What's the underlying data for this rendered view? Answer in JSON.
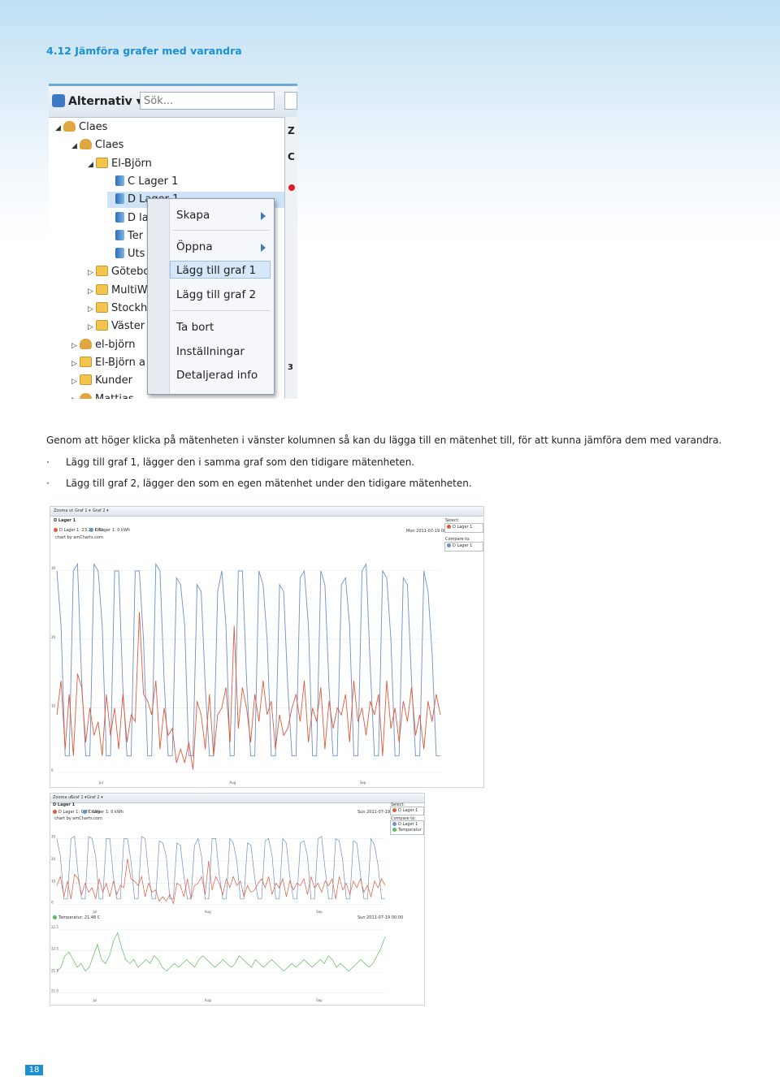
{
  "section_title": "4.12 Jämföra grafer med varandra",
  "screenshot1": {
    "toolbar": {
      "alternativ": "Alternativ",
      "search_placeholder": "Sök..."
    },
    "tree": [
      {
        "label": "Claes",
        "icon": "user-group-icon",
        "level": 0,
        "expanded": true
      },
      {
        "label": "Claes",
        "icon": "user-icon",
        "level": 1,
        "expanded": true
      },
      {
        "label": "El-Björn",
        "icon": "folder-icon",
        "level": 2,
        "expanded": true
      },
      {
        "label": "C Lager 1",
        "icon": "meter-icon",
        "level": 3
      },
      {
        "label": "D Lager 1",
        "icon": "meter-icon",
        "level": 3,
        "selected": true
      },
      {
        "label": "D la",
        "icon": "meter-icon",
        "level": 3
      },
      {
        "label": "Ter",
        "icon": "meter-icon",
        "level": 3
      },
      {
        "label": "Uts",
        "icon": "meter-icon",
        "level": 3
      },
      {
        "label": "Götebo",
        "icon": "folder-icon",
        "level": 2
      },
      {
        "label": "MultiW",
        "icon": "folder-icon",
        "level": 2
      },
      {
        "label": "Stockh",
        "icon": "folder-icon",
        "level": 2
      },
      {
        "label": "Väster",
        "icon": "folder-icon",
        "level": 2
      },
      {
        "label": "el-björn",
        "icon": "user-icon",
        "level": 1
      },
      {
        "label": "El-Björn a",
        "icon": "folder-icon",
        "level": 1
      },
      {
        "label": "Kunder",
        "icon": "folder-icon",
        "level": 1
      },
      {
        "label": "Mattias",
        "icon": "user-icon",
        "level": 1
      }
    ],
    "right_strip": [
      "Z",
      "C",
      "3"
    ],
    "context_menu": [
      {
        "label": "Skapa",
        "submenu": true
      },
      {
        "label": "Öppna",
        "submenu": true
      },
      {
        "label": "Lägg till graf 1",
        "highlighted": true
      },
      {
        "label": "Lägg till graf 2"
      },
      {
        "label": "Ta bort"
      },
      {
        "label": "Inställningar"
      },
      {
        "label": "Detaljerad info"
      }
    ]
  },
  "body": {
    "intro": "Genom att höger klicka på mätenheten i vänster kolumnen så kan du lägga till en mätenhet till, för att kunna jämföra dem med varandra.",
    "bullets": [
      "Lägg till graf 1, lägger den i samma graf som den tidigare mätenheten.",
      "Lägg till graf 2, lägger den som en egen mätenhet under den tidigare mätenheten."
    ]
  },
  "chart_screenshot_1": {
    "menu": [
      "Zooma ut",
      "Graf 1 ▾",
      "Graf 2 ▾"
    ],
    "title": "D Lager 1",
    "legend": [
      {
        "text": "D Lager 1: 23.25 kWh",
        "color": "#e05a3a"
      },
      {
        "text": "C Lager 1: 0 kWh",
        "color": "#6f8fc9"
      }
    ],
    "credit": "chart by amCharts.com",
    "date": "Mon 2011-07-19 00:00",
    "select_label": "Select:",
    "select_value": "D Lager 1",
    "compare_label": "Compare to:",
    "compare_items": [
      {
        "text": "D Lager 1",
        "color": "#6f8fc9"
      }
    ]
  },
  "chart_screenshot_2": {
    "menu": [
      "Zooma ut",
      "Graf 1 ▾",
      "Graf 2 ▾"
    ],
    "title": "D Lager 1",
    "legend": [
      {
        "text": "D Lager 1: 0.07 kWh",
        "color": "#e05a3a"
      },
      {
        "text": "C Lager 1: 0 kWh",
        "color": "#6f8fc9"
      }
    ],
    "credit": "chart by amCharts.com",
    "date": "Sun 2011-07-19 00:00",
    "select_label": "Select:",
    "select_value": "D Lager 1",
    "compare_label": "Compare to:",
    "compare_items": [
      {
        "text": "D Lager 1",
        "color": "#6f8fc9"
      },
      {
        "text": "Temperatur",
        "color": "#5cb85c"
      }
    ],
    "lower_legend": {
      "text": "Temperatur: 21.48 C",
      "color": "#5cb85c"
    },
    "lower_date": "Sun 2011-07-19 00:00"
  },
  "chart_data": [
    {
      "type": "line",
      "x_ticks": [
        "Jul",
        "Aug",
        "Sep"
      ],
      "y_ticks": [
        "0",
        "10",
        "20",
        "30"
      ],
      "ylim": [
        0,
        32
      ],
      "series": [
        {
          "name": "D Lager 1",
          "color": "#e05a3a",
          "values": [
            9,
            14,
            4,
            12,
            3,
            15,
            13,
            5,
            10,
            6,
            8,
            3,
            12,
            6,
            10,
            4,
            12,
            5,
            9,
            8,
            24,
            12,
            11,
            9,
            14,
            4,
            10,
            6,
            7,
            2,
            4,
            2,
            5,
            1,
            11,
            9,
            4,
            12,
            3,
            9,
            10,
            13,
            5,
            22,
            7,
            13,
            10,
            5,
            12,
            8,
            14,
            9,
            11,
            4,
            9,
            6,
            7,
            10,
            12,
            8,
            14,
            5,
            10,
            8,
            13,
            4,
            11,
            7,
            10,
            9,
            12,
            5,
            14,
            8,
            10,
            6,
            11,
            9,
            12,
            3,
            14,
            7,
            10,
            5,
            11,
            8,
            13,
            6,
            9,
            4,
            11,
            8,
            12,
            9
          ]
        },
        {
          "name": "C Lager 1",
          "color": "#6f8fc9",
          "values": [
            30,
            22,
            3,
            3,
            30,
            31,
            14,
            3,
            3,
            31,
            30,
            22,
            3,
            3,
            30,
            30,
            13,
            3,
            3,
            30,
            30,
            20,
            3,
            3,
            31,
            30,
            14,
            3,
            3,
            29,
            28,
            22,
            3,
            3,
            28,
            27,
            13,
            3,
            3,
            27,
            30,
            22,
            3,
            3,
            30,
            30,
            14,
            3,
            3,
            30,
            28,
            20,
            3,
            3,
            28,
            27,
            13,
            3,
            3,
            29,
            30,
            22,
            3,
            3,
            30,
            28,
            13,
            3,
            3,
            28,
            29,
            22,
            3,
            3,
            30,
            31,
            16,
            3,
            3,
            30,
            29,
            20,
            3,
            3,
            29,
            28,
            14,
            3,
            3,
            30,
            27,
            18,
            3,
            3
          ]
        }
      ]
    },
    {
      "type": "line",
      "x_ticks": [
        "Jul",
        "Aug",
        "Sep"
      ],
      "y_ticks": [
        "0",
        "10",
        "20",
        "30"
      ],
      "ylim": [
        0,
        32
      ],
      "series": [
        {
          "name": "D Lager 1",
          "color": "#e05a3a",
          "values": [
            9,
            13,
            4,
            11,
            3,
            14,
            12,
            5,
            10,
            6,
            8,
            3,
            12,
            6,
            10,
            4,
            11,
            5,
            9,
            8,
            21,
            12,
            11,
            9,
            13,
            4,
            10,
            6,
            7,
            2,
            4,
            2,
            5,
            1,
            10,
            9,
            4,
            12,
            3,
            9,
            10,
            13,
            5,
            20,
            7,
            13,
            10,
            5,
            12,
            8,
            13,
            9,
            11,
            4,
            9,
            6,
            7,
            10,
            12,
            8,
            13,
            5,
            10,
            8,
            12,
            4,
            11,
            7,
            10,
            9,
            12,
            5,
            13,
            8,
            10,
            6,
            11,
            9,
            12,
            3,
            13,
            7,
            10,
            5,
            11,
            8,
            12,
            6,
            9,
            4,
            11,
            8,
            12,
            9
          ]
        },
        {
          "name": "C Lager 1",
          "color": "#6f8fc9",
          "values": [
            30,
            22,
            3,
            3,
            30,
            31,
            14,
            3,
            3,
            31,
            30,
            22,
            3,
            3,
            30,
            30,
            13,
            3,
            3,
            30,
            30,
            20,
            3,
            3,
            31,
            30,
            14,
            3,
            3,
            29,
            28,
            22,
            3,
            3,
            28,
            27,
            13,
            3,
            3,
            27,
            30,
            22,
            3,
            3,
            30,
            30,
            14,
            3,
            3,
            30,
            28,
            20,
            3,
            3,
            28,
            27,
            13,
            3,
            3,
            29,
            30,
            22,
            3,
            3,
            30,
            28,
            13,
            3,
            3,
            28,
            29,
            22,
            3,
            3,
            30,
            31,
            16,
            3,
            3,
            30,
            29,
            20,
            3,
            3,
            29,
            28,
            14,
            3,
            3,
            30,
            27,
            18,
            3,
            3
          ]
        }
      ]
    },
    {
      "type": "line",
      "x_ticks": [
        "Jul",
        "Aug",
        "Sep"
      ],
      "y_ticks": [
        "21.0",
        "21.5",
        "22.0",
        "22.5"
      ],
      "ylim": [
        20.9,
        22.7
      ],
      "series": [
        {
          "name": "Temperatur",
          "color": "#5cb85c",
          "values": [
            21.5,
            21.6,
            21.9,
            22.0,
            21.8,
            21.6,
            21.7,
            21.5,
            21.6,
            21.9,
            22.2,
            21.8,
            21.7,
            21.9,
            22.3,
            22.5,
            22.1,
            21.8,
            21.7,
            21.8,
            21.6,
            21.7,
            21.8,
            21.7,
            21.9,
            21.8,
            21.6,
            21.5,
            21.6,
            21.7,
            21.6,
            21.7,
            21.8,
            21.7,
            21.6,
            21.8,
            21.9,
            21.8,
            21.7,
            21.6,
            21.7,
            21.8,
            21.7,
            21.6,
            21.7,
            21.9,
            21.8,
            21.7,
            21.6,
            21.8,
            21.7,
            21.6,
            21.7,
            21.8,
            21.7,
            21.6,
            21.5,
            21.6,
            21.7,
            21.6,
            21.7,
            21.8,
            21.7,
            21.6,
            21.7,
            21.8,
            21.7,
            21.9,
            21.8,
            21.6,
            21.7,
            21.6,
            21.5,
            21.6,
            21.7,
            21.8,
            21.7,
            21.6,
            21.7,
            21.9,
            22.1,
            22.4
          ]
        }
      ]
    }
  ],
  "page_number": "18"
}
